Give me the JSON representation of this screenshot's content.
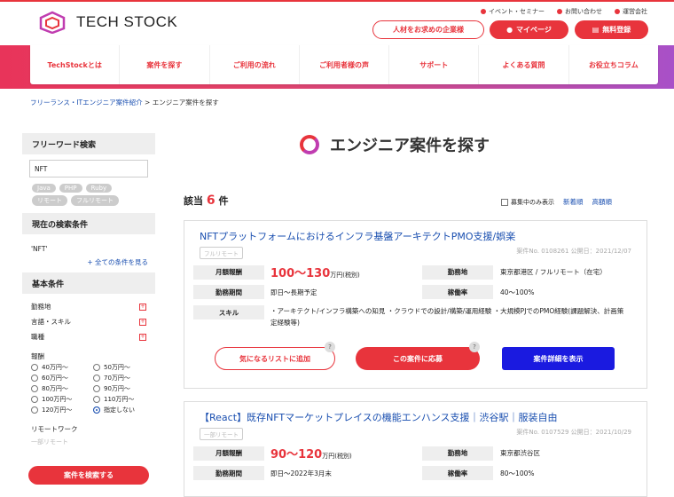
{
  "header": {
    "logo_text": "TECH STOCK",
    "top_links": [
      "イベント・セミナー",
      "お問い合わせ",
      "運営会社"
    ],
    "btn_company": "人材をお求めの企業様",
    "btn_mypage": "マイページ",
    "btn_register": "無料登録"
  },
  "nav": [
    "TechStockとは",
    "案件を探す",
    "ご利用の流れ",
    "ご利用者様の声",
    "サポート",
    "よくある質問",
    "お役立ちコラム"
  ],
  "breadcrumb": {
    "link": "フリーランス・ITエンジニア案件紹介",
    "sep": ">",
    "current": "エンジニア案件を探す"
  },
  "page_title": "エンジニア案件を探す",
  "sidebar": {
    "freeword_title": "フリーワード検索",
    "freeword_value": "NFT",
    "tags": [
      "Java",
      "PHP",
      "Ruby",
      "リモート",
      "フルリモート"
    ],
    "current_title": "現在の検索条件",
    "current_value": "'NFT'",
    "see_all": "+ 全ての条件を見る",
    "basic_title": "基本条件",
    "basic_items": [
      "勤務地",
      "言語・スキル",
      "職種"
    ],
    "pay_title": "報酬",
    "pay_options": [
      "40万円〜",
      "50万円〜",
      "60万円〜",
      "70万円〜",
      "80万円〜",
      "90万円〜",
      "100万円〜",
      "110万円〜",
      "120万円〜",
      "指定しない"
    ],
    "remote_title": "リモートワーク",
    "remote_partial": "一部リモート",
    "search_button": "案件を検索する"
  },
  "results": {
    "prefix": "該当",
    "count": "6",
    "suffix": "件",
    "recruiting_only": "募集中のみ表示",
    "sort_new": "新着順",
    "sort_price": "高額順"
  },
  "jobs": [
    {
      "title": "NFTプラットフォームにおけるインフラ基盤アーキテクトPMO支援/娯楽",
      "badge": "フルリモート",
      "meta": "案件No. 0108261 公開日：2021/12/07",
      "pay_label": "月額報酬",
      "pay": "100〜130",
      "pay_unit": "万円(税別)",
      "place_label": "勤務地",
      "place": "東京都港区 / フルリモート（在宅）",
      "period_label": "勤務期間",
      "period": "即日〜長期予定",
      "rate_label": "稼働率",
      "rate": "40〜100%",
      "skill_label": "スキル",
      "skill": "・アーキテクト/インフラ構築への知見 ・クラウドでの設計/構築/運用経験 ・大規模PJでのPMO経験(課題解決、計画策定経験等)",
      "btn_fav": "気になるリストに追加",
      "btn_apply": "この案件に応募",
      "btn_detail": "案件詳細を表示"
    },
    {
      "title": "【React】既存NFTマーケットプレイスの機能エンハンス支援｜渋谷駅｜服装自由",
      "badge": "一部リモート",
      "meta": "案件No. 0107529 公開日：2021/10/29",
      "pay_label": "月額報酬",
      "pay": "90〜120",
      "pay_unit": "万円(税別)",
      "place_label": "勤務地",
      "place": "東京都渋谷区",
      "period_label": "勤務期間",
      "period": "即日〜2022年3月末",
      "rate_label": "稼働率",
      "rate": "80〜100%"
    }
  ]
}
